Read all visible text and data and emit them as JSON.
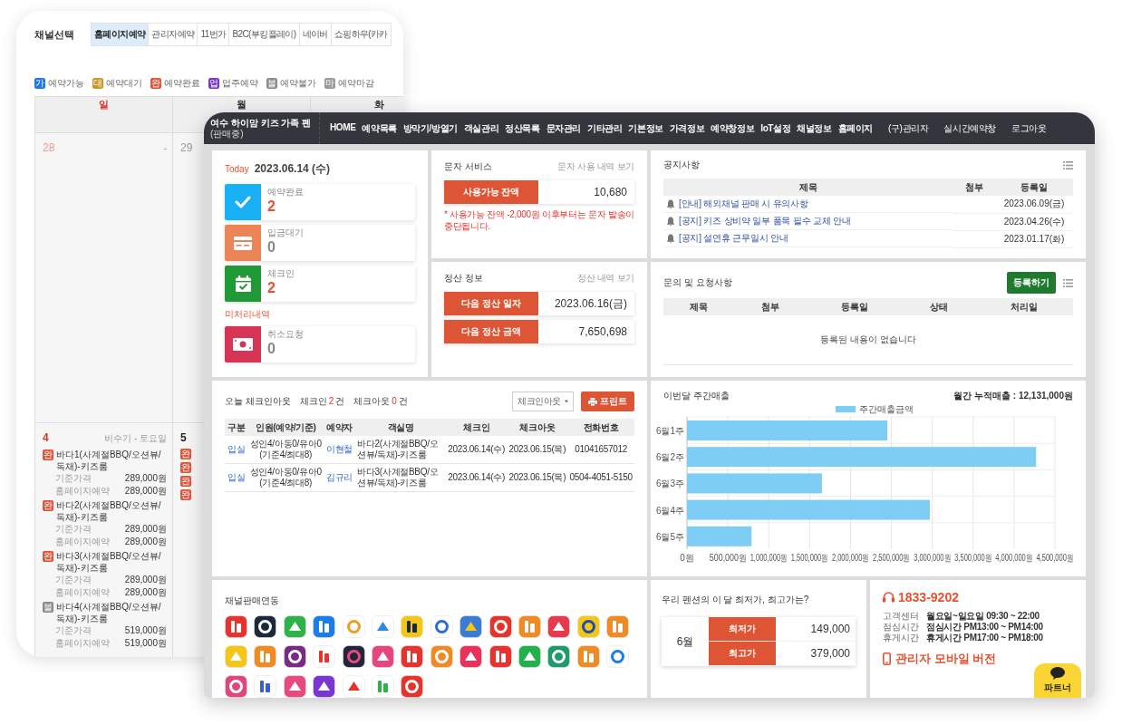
{
  "back_window": {
    "title": "채널선택",
    "tabs": [
      {
        "label": "홈페이지예약",
        "selected": true
      },
      {
        "label": "관리자예약",
        "selected": false
      },
      {
        "label": "11번가",
        "selected": false
      },
      {
        "label": "B2C(부킹플레이)",
        "selected": false
      },
      {
        "label": "네이버",
        "selected": false
      },
      {
        "label": "쇼핑하우(카카",
        "selected": false
      }
    ],
    "legend": [
      {
        "badge": "가",
        "label": "예약가능",
        "color": "#1f78e6"
      },
      {
        "badge": "대",
        "label": "예약대기",
        "color": "#c8962a"
      },
      {
        "badge": "완",
        "label": "예약완료",
        "color": "#e0533a"
      },
      {
        "badge": "업",
        "label": "업주예약",
        "color": "#7b35c9"
      },
      {
        "badge": "불",
        "label": "예약불가",
        "color": "#8a8a8a"
      },
      {
        "badge": "마",
        "label": "예약마감",
        "color": "#9a9a9a"
      }
    ],
    "weekdays": [
      "일",
      "월",
      "화"
    ],
    "weeks": [
      {
        "days": [
          {
            "date": "28",
            "other_month": true,
            "note": "-"
          },
          {
            "date": "29",
            "other_month": true
          }
        ]
      },
      {
        "days": [
          {
            "date": "4",
            "other_month": false,
            "note": "비수기 - 토요일",
            "rooms": [
              {
                "badge": "완",
                "color": "#e0533a",
                "name": "바다1(사계절BBQ/오션뷰/독채)-키즈룸",
                "prices": [
                  {
                    "label": "기준가격",
                    "value": "289,000원"
                  },
                  {
                    "label": "홈페이지예약",
                    "value": "289,000원"
                  }
                ]
              },
              {
                "badge": "완",
                "color": "#e0533a",
                "name": "바다2(사계절BBQ/오션뷰/독채)-키즈룸",
                "prices": [
                  {
                    "label": "기준가격",
                    "value": "289,000원"
                  },
                  {
                    "label": "홈페이지예약",
                    "value": "289,000원"
                  }
                ]
              },
              {
                "badge": "완",
                "color": "#e0533a",
                "name": "바다3(사계절BBQ/오션뷰/독채)-키즈룸",
                "prices": [
                  {
                    "label": "기준가격",
                    "value": "289,000원"
                  },
                  {
                    "label": "홈페이지예약",
                    "value": "289,000원"
                  }
                ]
              },
              {
                "badge": "불",
                "color": "#8a8a8a",
                "name": "바다4(사계절BBQ/오션뷰/독채)-키즈룸",
                "prices": [
                  {
                    "label": "기준가격",
                    "value": "519,000원"
                  },
                  {
                    "label": "홈페이지예약",
                    "value": "519,000원"
                  }
                ]
              }
            ]
          },
          {
            "date": "5",
            "other_month": false,
            "rooms": [
              {
                "badge": "완",
                "color": "#e0533a"
              },
              {
                "badge": "완",
                "color": "#e0533a"
              },
              {
                "badge": "완",
                "color": "#e0533a"
              },
              {
                "badge": "완",
                "color": "#e0533a"
              }
            ]
          }
        ]
      }
    ]
  },
  "header": {
    "brand": "여수 하이맘 키즈 가족 펜",
    "status": "(판매중)",
    "nav": [
      "HOME",
      "예약목록",
      "방막기/방열기",
      "객실관리",
      "정산목록",
      "문자관리",
      "기타관리",
      "기본정보",
      "가격정보",
      "예약창정보",
      "IoT설정",
      "채널정보",
      "홈페이지",
      "(구)관리자",
      "실시간예약창",
      "로그아웃"
    ]
  },
  "today": {
    "label": "Today",
    "date": "2023.06.14 (수)",
    "groups": [
      {
        "cards": [
          {
            "kind": "check",
            "color": "#1ab0f5",
            "label": "예약완료",
            "count": "2",
            "alert": true
          },
          {
            "kind": "card",
            "color": "#eb8558",
            "label": "입금대기",
            "count": "0",
            "alert": false
          },
          {
            "kind": "calendar",
            "color": "#1f9a36",
            "label": "체크인",
            "count": "2",
            "alert": true
          }
        ]
      },
      {
        "title": "미처리내역",
        "cards": [
          {
            "kind": "money",
            "color": "#d63454",
            "label": "취소요청",
            "count": "0",
            "alert": false
          }
        ]
      }
    ]
  },
  "sms": {
    "title": "문자 서비스",
    "link": "문자 사용 내역 보기",
    "rows": [
      {
        "label": "사용가능 잔액",
        "value": "10,680"
      }
    ],
    "note": "* 사용가능 잔액 -2,000원 이후부터는 문자 발송이 중단됩니다."
  },
  "settlement": {
    "title": "정산 정보",
    "link": "정산 내역 보기",
    "rows": [
      {
        "label": "다음 정산 일자",
        "value": "2023.06.16(금)"
      },
      {
        "label": "다음 정산 금액",
        "value": "7,650,698"
      }
    ]
  },
  "notices": {
    "title": "공지사항",
    "columns": [
      "제목",
      "첨부",
      "등록일"
    ],
    "rows": [
      {
        "title": "[안내] 해외채널 판매 시 유의사항",
        "date": "2023.06.09(금)"
      },
      {
        "title": "[공지] 키즈 상비약 일부 품목 필수 교체 안내",
        "date": "2023.04.26(수)"
      },
      {
        "title": "[공지] 설연휴 근무일시 안내",
        "date": "2023.01.17(화)"
      }
    ]
  },
  "inquiries": {
    "title": "문의 및 요청사항",
    "button": "등록하기",
    "columns": [
      "제목",
      "첨부",
      "등록일",
      "상태",
      "처리일"
    ],
    "empty": "등록된 내용이 없습니다"
  },
  "checkins": {
    "title": "오늘 체크인아웃",
    "summary": [
      {
        "label": "체크인",
        "count": "2",
        "unit": "건"
      },
      {
        "label": "체크아웃",
        "count": "0",
        "unit": "건"
      }
    ],
    "filter": "체크인아웃",
    "print": "프린트",
    "columns": [
      "구분",
      "인원(예약/기준)",
      "예약자",
      "객실명",
      "체크인",
      "체크아웃",
      "전화번호"
    ],
    "rows": [
      {
        "type": "입실",
        "people": [
          "성인4/아동0/유아0",
          "(기준4/최대8)"
        ],
        "guest": "이현철",
        "room": "바다2(사계절BBQ/오션뷰/독채)-키즈룸",
        "checkin": "2023.06.14(수)",
        "checkout": "2023.06.15(목)",
        "phone": "01041657012"
      },
      {
        "type": "입실",
        "people": [
          "성인4/아동0/유아0",
          "(기준4/최대8)"
        ],
        "guest": "김규리",
        "room": "바다3(사계절BBQ/오션뷰/독채)-키즈룸",
        "checkin": "2023.06.14(수)",
        "checkout": "2023.06.15(목)",
        "phone": "0504-4051-5150"
      }
    ]
  },
  "sales": {
    "total": "월간 누적매출 : 12,131,000원",
    "chart_data": {
      "type": "bar",
      "orientation": "horizontal",
      "title": "이번달 주간매출",
      "categories": [
        "6월1주",
        "6월2주",
        "6월3주",
        "6월4주",
        "6월5주"
      ],
      "series": [
        {
          "name": "주간매출금액",
          "color": "#7dcdf5",
          "values": [
            2450000,
            4270000,
            1650000,
            2970000,
            790000
          ]
        }
      ],
      "grid": true,
      "xlim": [
        0,
        4500000
      ],
      "xticks": [
        {
          "value": 0,
          "label": "0원"
        },
        {
          "value": 500000,
          "label": "500,000원"
        },
        {
          "value": 1000000,
          "label": "1,000,000원"
        },
        {
          "value": 1500000,
          "label": "1,500,000원"
        },
        {
          "value": 2000000,
          "label": "2,000,000원"
        },
        {
          "value": 2500000,
          "label": "2,500,000원"
        },
        {
          "value": 3000000,
          "label": "3,000,000원"
        },
        {
          "value": 3500000,
          "label": "3,500,000원"
        },
        {
          "value": 4000000,
          "label": "4,000,000원"
        },
        {
          "value": 4500000,
          "label": "4,500,000원"
        }
      ]
    }
  },
  "channels": {
    "title": "채널판매연동"
  },
  "prices": {
    "title": "우리 펜션의 이 달 최저가, 최고가는?",
    "month": "6월",
    "rows": [
      {
        "label": "최저가",
        "value": "149,000"
      },
      {
        "label": "최고가",
        "value": "379,000"
      }
    ]
  },
  "contact": {
    "phone": "1833-9202",
    "hours": [
      {
        "label": "고객센터",
        "value": "월요일~일요일 09:30 ~ 22:00"
      },
      {
        "label": "점심시간",
        "value": "점심시간 PM13:00 ~ PM14:00"
      },
      {
        "label": "휴게시간",
        "value": "휴게시간 PM17:00 ~ PM18:00"
      }
    ],
    "mobile": "관리자 모바일 버전"
  },
  "partner": {
    "label": "파트너"
  }
}
